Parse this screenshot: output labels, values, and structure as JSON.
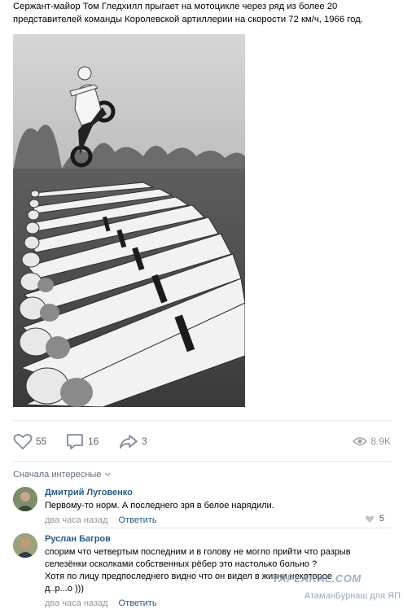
{
  "post": {
    "caption": "Сержант-майор Том Гледхилл прыгает на мотоцикле через ряд из более 20 представителей команды Королевской артиллерии на скорости 72 км/ч, 1966 год.",
    "likes": "55",
    "comments": "16",
    "shares": "3",
    "views": "8.9K"
  },
  "sort_label": "Сначала интересные",
  "comments": [
    {
      "author": "Дмитрий Луговенко",
      "text": "Первому-то норм. А последнего зря в белое нарядили.",
      "time": "два часа назад",
      "reply": "Ответить",
      "likes": "5"
    },
    {
      "author": "Руслан Багров",
      "text_line1": "спорим что четвертым последним и в голову не могло прийти что разрыв",
      "text_line2": "селезёнки осколками собственных рёбер это настолько больно ?",
      "text_line3": "Хотя по лицу предпоследнего видно что он видел в жизни некоторое",
      "text_line4": "д..р...о )))",
      "time": "два часа назад",
      "reply": "Ответить"
    }
  ],
  "watermark": {
    "site": "YAPLAKAL.COM",
    "credit": "АтаманБурнаш для ЯП"
  },
  "icons": {
    "like": "heart-icon",
    "comment": "speech-bubble-icon",
    "share": "share-arrow-icon",
    "views": "eye-icon",
    "sort": "chevron-down-icon"
  }
}
